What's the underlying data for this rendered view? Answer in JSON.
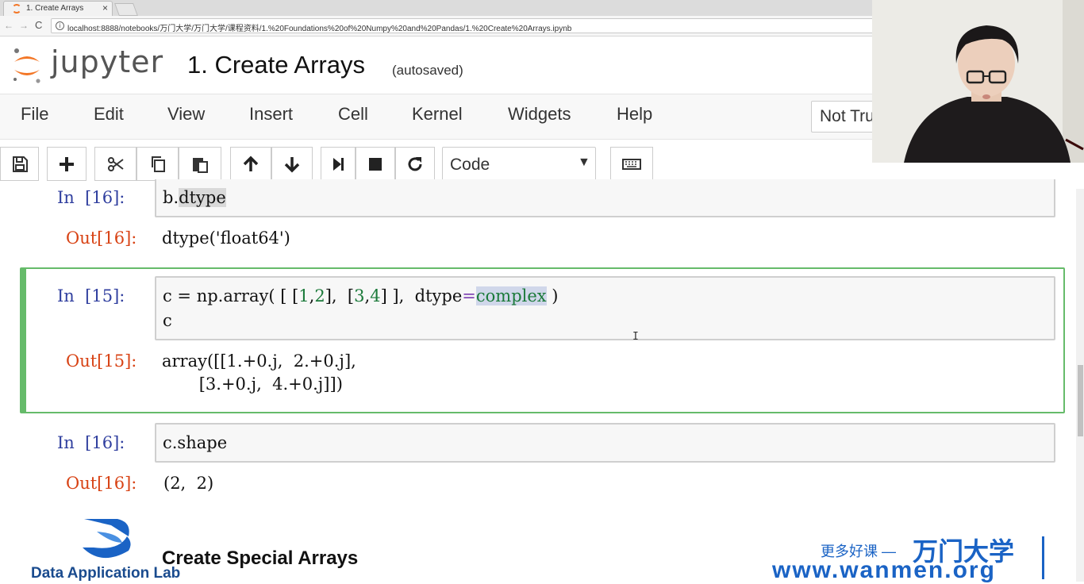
{
  "browser": {
    "tab_title": "1. Create Arrays",
    "tab_close": "×",
    "url": "localhost:8888/notebooks/万门大学/万门大学/课程资料/1.%20Foundations%20of%20Numpy%20and%20Pandas/1.%20Create%20Arrays.ipynb",
    "back": "←",
    "forward": "→",
    "reload": "C",
    "info": "i"
  },
  "header": {
    "logo_text": "jupyter",
    "title": "1. Create Arrays",
    "autosave": "(autosaved)"
  },
  "menu": {
    "items": [
      "File",
      "Edit",
      "View",
      "Insert",
      "Cell",
      "Kernel",
      "Widgets",
      "Help"
    ],
    "trust": "Not Trusted"
  },
  "toolbar": {
    "buttons": [
      "save-icon",
      "plus-icon",
      "scissors-icon",
      "copy-icon",
      "paste-icon",
      "arrow-up-icon",
      "arrow-down-icon",
      "step-forward-icon",
      "stop-icon",
      "restart-icon",
      "keyboard-icon"
    ],
    "celltype": "Code",
    "celltype_arrow": "▼"
  },
  "cells": {
    "c1": {
      "in_prompt": "In  [16]:",
      "code_a": "b.",
      "code_b": "dtype",
      "out_prompt": "Out[16]:",
      "output": "dtype('float64')"
    },
    "c2": {
      "in_prompt": "In  [15]:",
      "line1_a": "c = np.array( [ [",
      "n1": "1",
      "comma1": ",",
      "n2": "2",
      "line1_b": "],  [",
      "n3": "3",
      "comma2": ",",
      "n4": "4",
      "line1_c": "] ],  dtype",
      "eq": "=",
      "kw": "complex",
      "line1_d": " )",
      "line2": "c",
      "out_prompt": "Out[15]:",
      "out_line1": "array([[1.+0.j,  2.+0.j],",
      "out_line2": "       [3.+0.j,  4.+0.j]])"
    },
    "c3": {
      "in_prompt": "In  [16]:",
      "code": "c.shape",
      "out_prompt": "Out[16]:",
      "output": "(2,  2)"
    }
  },
  "overlay": {
    "dal_text": "Data Application Lab",
    "section_heading": "Create Special Arrays",
    "watermark_more": "更多好课 —",
    "watermark_brand": "万门大学",
    "watermark_url": "www.wanmen.org",
    "cursor": "I"
  },
  "colors": {
    "accent_orange": "#f37626",
    "selected_border": "#66bb6a",
    "prompt_in": "#303f9f",
    "prompt_out": "#d84315",
    "watermark": "#1a63c5"
  }
}
